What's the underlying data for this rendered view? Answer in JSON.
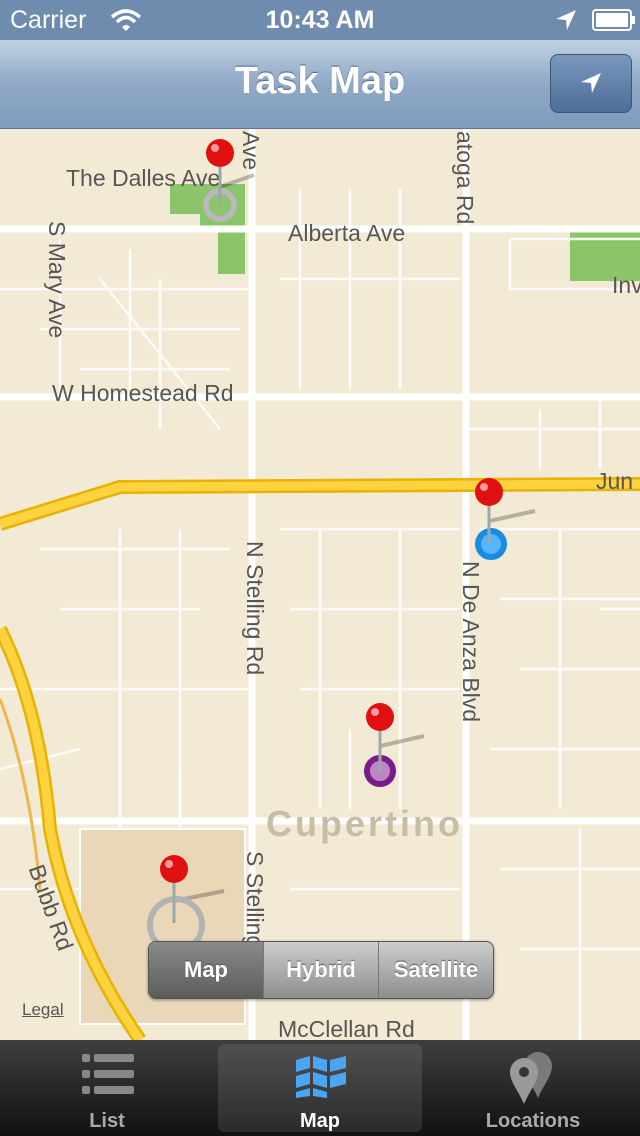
{
  "status_bar": {
    "carrier": "Carrier",
    "time": "10:43 AM"
  },
  "nav": {
    "title": "Task Map",
    "location_button": "location-arrow-icon"
  },
  "map": {
    "street_labels": {
      "the_dalles": "The Dalles Ave",
      "alberta": "Alberta Ave",
      "s_mary": "S Mary Ave",
      "w_homestead": "W Homestead Rd",
      "saratoga": "atoga Rd",
      "inv": "Inv",
      "jun": "Jun",
      "n_stelling": "N Stelling Rd",
      "n_de_anza": "N De Anza Blvd",
      "cupertino": "Cupertino",
      "bubb": "Bubb Rd",
      "s_stelling": "S Stelling Rd",
      "mcclellan": "McClellan Rd",
      "ave_top": "Ave"
    },
    "legal": "Legal",
    "pins": [
      {
        "ring_color": "#b9b9b9"
      },
      {
        "ring_color": "#1a8be0"
      },
      {
        "ring_color": "#7a1d8a"
      },
      {
        "ring_color": "#b3b3b3"
      }
    ]
  },
  "map_type_control": {
    "options": [
      "Map",
      "Hybrid",
      "Satellite"
    ],
    "selected": "Map"
  },
  "tab_bar": {
    "items": [
      {
        "label": "List",
        "icon": "list-icon"
      },
      {
        "label": "Map",
        "icon": "map-icon"
      },
      {
        "label": "Locations",
        "icon": "locations-pin-icon"
      }
    ],
    "selected": "Map"
  }
}
